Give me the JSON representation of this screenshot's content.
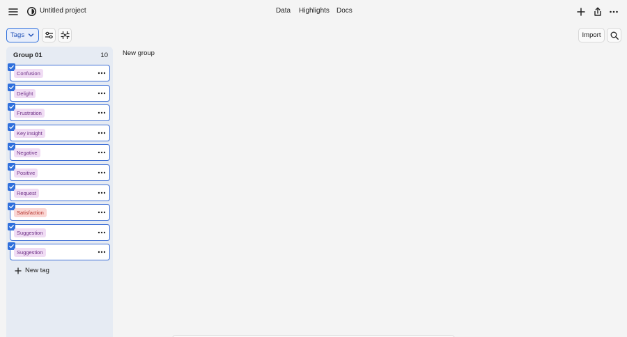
{
  "app": {
    "project_title": "Untitled project",
    "nav": [
      "Data",
      "Highlights",
      "Docs"
    ]
  },
  "toolbar": {
    "tags_label": "Tags",
    "import_label": "Import"
  },
  "group": {
    "name": "Group 01",
    "count": "10",
    "tags": [
      {
        "label": "Confusion",
        "checked": true,
        "color": "#f0dcf4"
      },
      {
        "label": "Delight",
        "checked": true,
        "color": "#f0dcf4"
      },
      {
        "label": "Frustration",
        "checked": true,
        "color": "#f0dcf4"
      },
      {
        "label": "Key insight",
        "checked": true,
        "color": "#f0dcf4"
      },
      {
        "label": "Negative",
        "checked": true,
        "color": "#f0dcf4"
      },
      {
        "label": "Positive",
        "checked": true,
        "color": "#f0dcf4"
      },
      {
        "label": "Request",
        "checked": true,
        "color": "#f0dcf4"
      },
      {
        "label": "Satisfaction",
        "checked": true,
        "color": "#fbd7d4"
      },
      {
        "label": "Suggestion",
        "checked": true,
        "color": "#f0dcf4"
      },
      {
        "label": "Suggestion",
        "checked": true,
        "color": "#f0dcf4"
      }
    ],
    "new_tag_label": "New tag"
  },
  "new_group_label": "New group",
  "colors": {
    "accent": "#2f6fdc",
    "panel": "#e6ebf3",
    "chip_purple": "#f0dcf4",
    "chip_red": "#fbd7d4"
  }
}
